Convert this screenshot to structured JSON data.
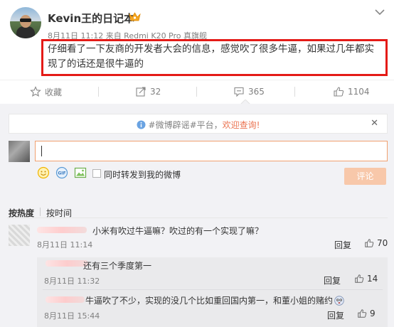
{
  "post": {
    "username": "Kevin王的日记本",
    "meta": "8月11日 11:12 来自 Redmi K20 Pro 真旗舰",
    "text": "仔细看了一下友商的开发者大会的信息，感觉吹了很多牛逼，如果过几年都实现了的话还是很牛逼的",
    "highlight_color": "#e41b17"
  },
  "actions": {
    "favorite": "收藏",
    "repost_count": "32",
    "comment_count": "365",
    "like_count": "1104"
  },
  "notice": {
    "prefix": "#微博辟谣#平台，",
    "highlight": "欢迎查询!",
    "close": "✕"
  },
  "composer": {
    "repost_label": "同时转发到我的微博",
    "submit": "评论"
  },
  "sort": {
    "hot": "按热度",
    "time": "按时间"
  },
  "comments": [
    {
      "text": "小米有吹过牛逼嘛？吹过的有一个实现了嘛？",
      "time": "8月11日 11:14",
      "reply": "回复",
      "likes": "70"
    }
  ],
  "replies": [
    {
      "text": "还有三个季度第一",
      "time": "8月11日 11:32",
      "reply": "回复",
      "likes": "14"
    },
    {
      "text": "牛逼吹了不少，实现的没几个比如重回国内第一，和董小姐的赌约",
      "time": "8月11日 15:44",
      "reply": "回复",
      "likes": "9"
    }
  ],
  "colors": {
    "accent": "#eb7350",
    "submit_bg": "#f8c8aa",
    "gray_text": "#808080"
  }
}
